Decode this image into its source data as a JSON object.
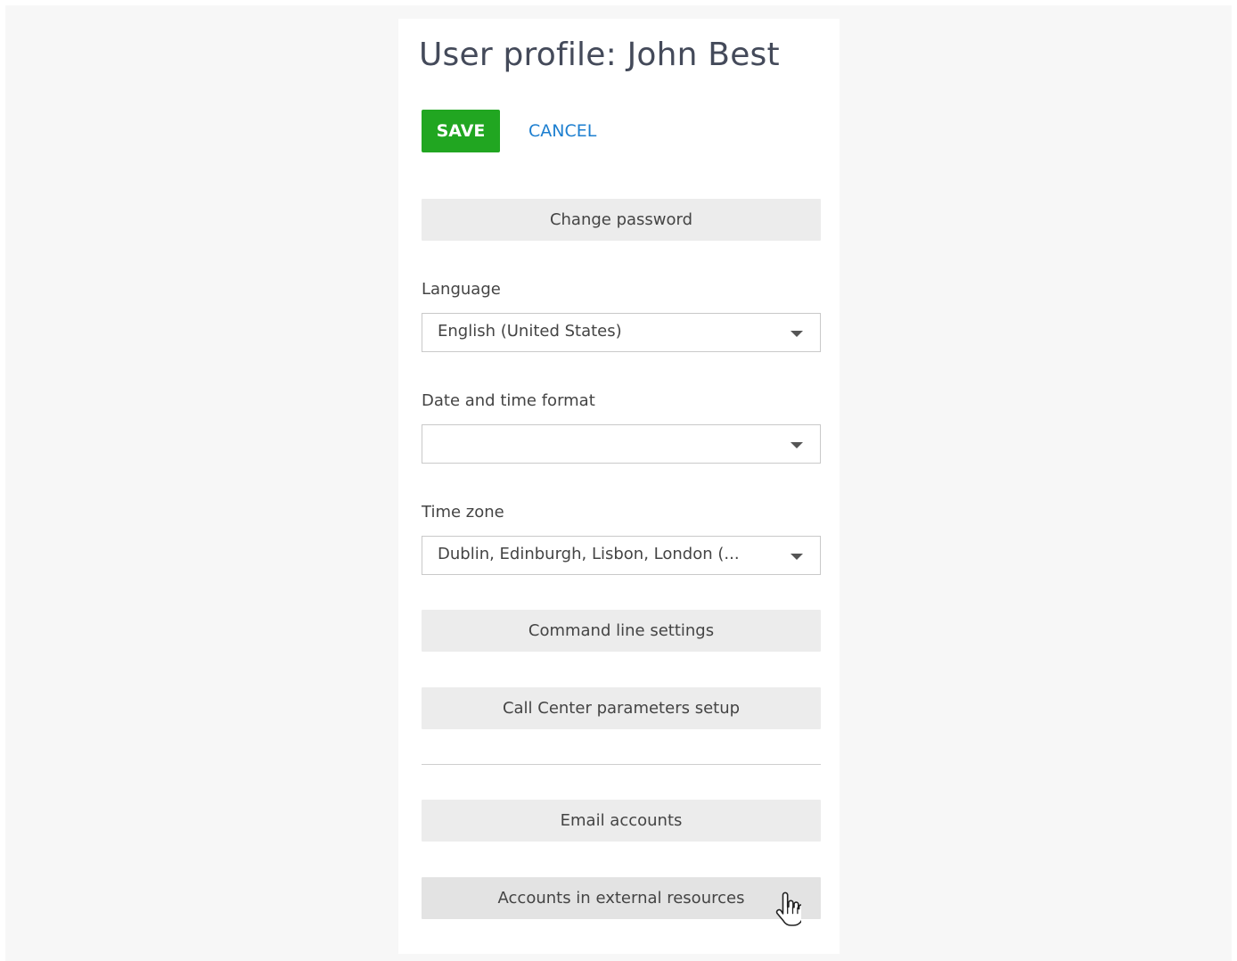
{
  "profile": {
    "title": "User profile: John Best"
  },
  "actions": {
    "save_label": "SAVE",
    "cancel_label": "CANCEL"
  },
  "buttons": {
    "change_password": "Change password",
    "command_line_settings": "Command line settings",
    "call_center_setup": "Call Center parameters setup",
    "email_accounts": "Email accounts",
    "external_accounts": "Accounts in external resources"
  },
  "fields": {
    "language": {
      "label": "Language",
      "value": "English (United States)"
    },
    "date_time_format": {
      "label": "Date and time format",
      "value": ""
    },
    "time_zone": {
      "label": "Time zone",
      "value": "Dublin, Edinburgh, Lisbon, London (..."
    }
  },
  "colors": {
    "save_button": "#21a621",
    "cancel_link": "#1d7fd0",
    "secondary_button": "#ececec",
    "page_background": "#f7f7f7"
  },
  "icons": {
    "dropdown": "chevron-down-icon",
    "cursor": "hand-pointer-icon"
  }
}
